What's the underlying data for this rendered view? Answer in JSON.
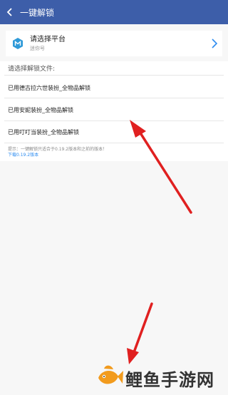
{
  "appbar": {
    "title": "一键解锁",
    "back_icon": "back-arrow-icon",
    "color": "#3d5ea9"
  },
  "platform": {
    "title": "请选择平台",
    "subtitle": "迷你号",
    "icon": "app-logo-m-icon",
    "chevron_icon": "chevron-right-icon"
  },
  "files": {
    "header": "请选择解锁文件:",
    "items": [
      {
        "label": "已用德古拉六世装扮_全物品解锁"
      },
      {
        "label": "已用安妮装扮_全物品解锁"
      },
      {
        "label": "已用叮叮当装扮_全物品解锁"
      }
    ]
  },
  "note": {
    "text": "提示：一键解锁只适合于0.19.2版本和之前的版本！",
    "link": "下载0.19.2版本"
  },
  "annotations": {
    "arrow_color": "#e02020",
    "arrow_icons": [
      "red-arrow-upper",
      "red-arrow-lower"
    ]
  },
  "watermark": {
    "text": "鲤鱼手游网",
    "logo_icon": "fish-logo-icon",
    "logo_color": "#f29b1d"
  }
}
